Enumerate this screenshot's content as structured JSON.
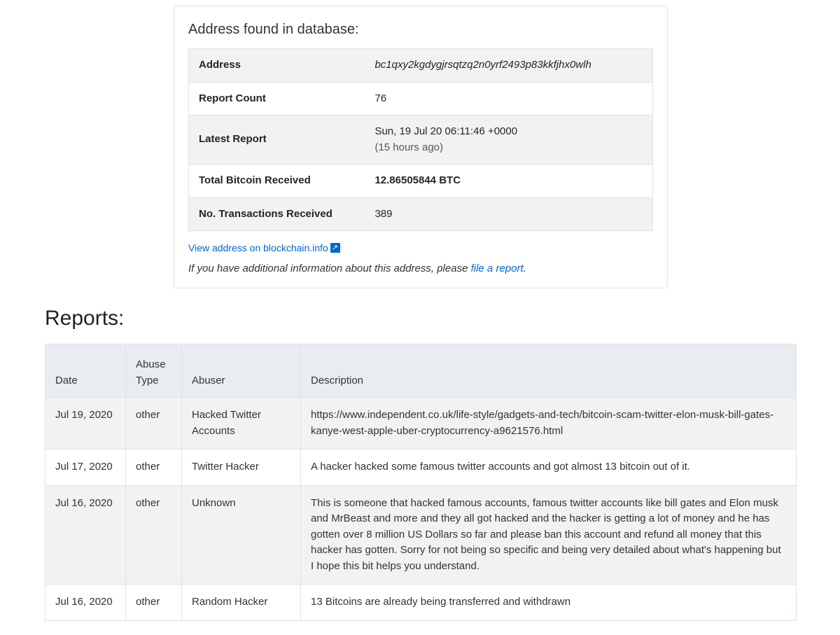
{
  "card": {
    "title": "Address found in database:",
    "rows": [
      {
        "label": "Address",
        "value": "bc1qxy2kgdygjrsqtzq2n0yrf2493p83kkfjhx0wlh",
        "italic": true
      },
      {
        "label": "Report Count",
        "value": "76"
      },
      {
        "label": "Latest Report",
        "value": "Sun, 19 Jul 20 06:11:46 +0000",
        "sub": "(15 hours ago)"
      },
      {
        "label": "Total Bitcoin Received",
        "value": "12.86505844 BTC",
        "bold": true
      },
      {
        "label": "No. Transactions Received",
        "value": "389"
      }
    ],
    "blockchain_link": "View address on blockchain.info",
    "note_pre": "If you have additional information about this address, please ",
    "note_link": "file a report",
    "note_post": "."
  },
  "reports": {
    "heading": "Reports:",
    "headers": {
      "date": "Date",
      "abuse_type": "Abuse Type",
      "abuser": "Abuser",
      "description": "Description"
    },
    "rows": [
      {
        "date": "Jul 19, 2020",
        "type": "other",
        "abuser": "Hacked Twitter Accounts",
        "desc": "https://www.independent.co.uk/life-style/gadgets-and-tech/bitcoin-scam-twitter-elon-musk-bill-gates-kanye-west-apple-uber-cryptocurrency-a9621576.html"
      },
      {
        "date": "Jul 17, 2020",
        "type": "other",
        "abuser": "Twitter Hacker",
        "desc": "A hacker hacked some famous twitter accounts and got almost 13 bitcoin out of it."
      },
      {
        "date": "Jul 16, 2020",
        "type": "other",
        "abuser": "Unknown",
        "desc": "This is someone that hacked famous accounts, famous twitter accounts like bill gates and Elon musk and MrBeast and more and they all got hacked and the hacker is getting a lot of money and he has gotten over 8 million US Dollars so far and please ban this account and refund all money that this hacker has gotten. Sorry for not being so specific and being very detailed about what's happening but I hope this bit helps you understand."
      },
      {
        "date": "Jul 16, 2020",
        "type": "other",
        "abuser": "Random Hacker",
        "desc": "13 Bitcoins are already being transferred and withdrawn"
      }
    ]
  }
}
